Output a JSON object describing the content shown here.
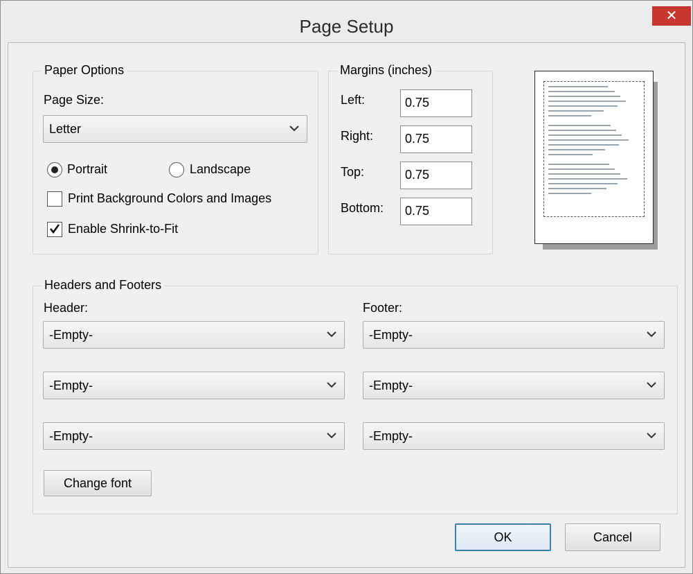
{
  "window": {
    "title": "Page Setup",
    "close_glyph": "✕"
  },
  "paper_options": {
    "legend": "Paper Options",
    "page_size_label": "Page Size:",
    "page_size_value": "Letter",
    "orientation": {
      "portrait_label": "Portrait",
      "landscape_label": "Landscape",
      "selected": "portrait"
    },
    "print_background_label": "Print Background Colors and Images",
    "print_background_checked": false,
    "shrink_to_fit_label": "Enable Shrink-to-Fit",
    "shrink_to_fit_checked": true
  },
  "margins": {
    "legend": "Margins (inches)",
    "left_label": "Left:",
    "left_value": "0.75",
    "right_label": "Right:",
    "right_value": "0.75",
    "top_label": "Top:",
    "top_value": "0.75",
    "bottom_label": "Bottom:",
    "bottom_value": "0.75"
  },
  "headers_footers": {
    "legend": "Headers and Footers",
    "header_label": "Header:",
    "footer_label": "Footer:",
    "header_values": [
      "-Empty-",
      "-Empty-",
      "-Empty-"
    ],
    "footer_values": [
      "-Empty-",
      "-Empty-",
      "-Empty-"
    ],
    "change_font_label": "Change font"
  },
  "actions": {
    "ok_label": "OK",
    "cancel_label": "Cancel"
  },
  "icons": {
    "close": "close-icon",
    "dropdown": "chevron-down-icon",
    "check": "checkmark-icon"
  },
  "colors": {
    "close_button": "#c7372f",
    "default_button_border": "#3c7fb1"
  }
}
